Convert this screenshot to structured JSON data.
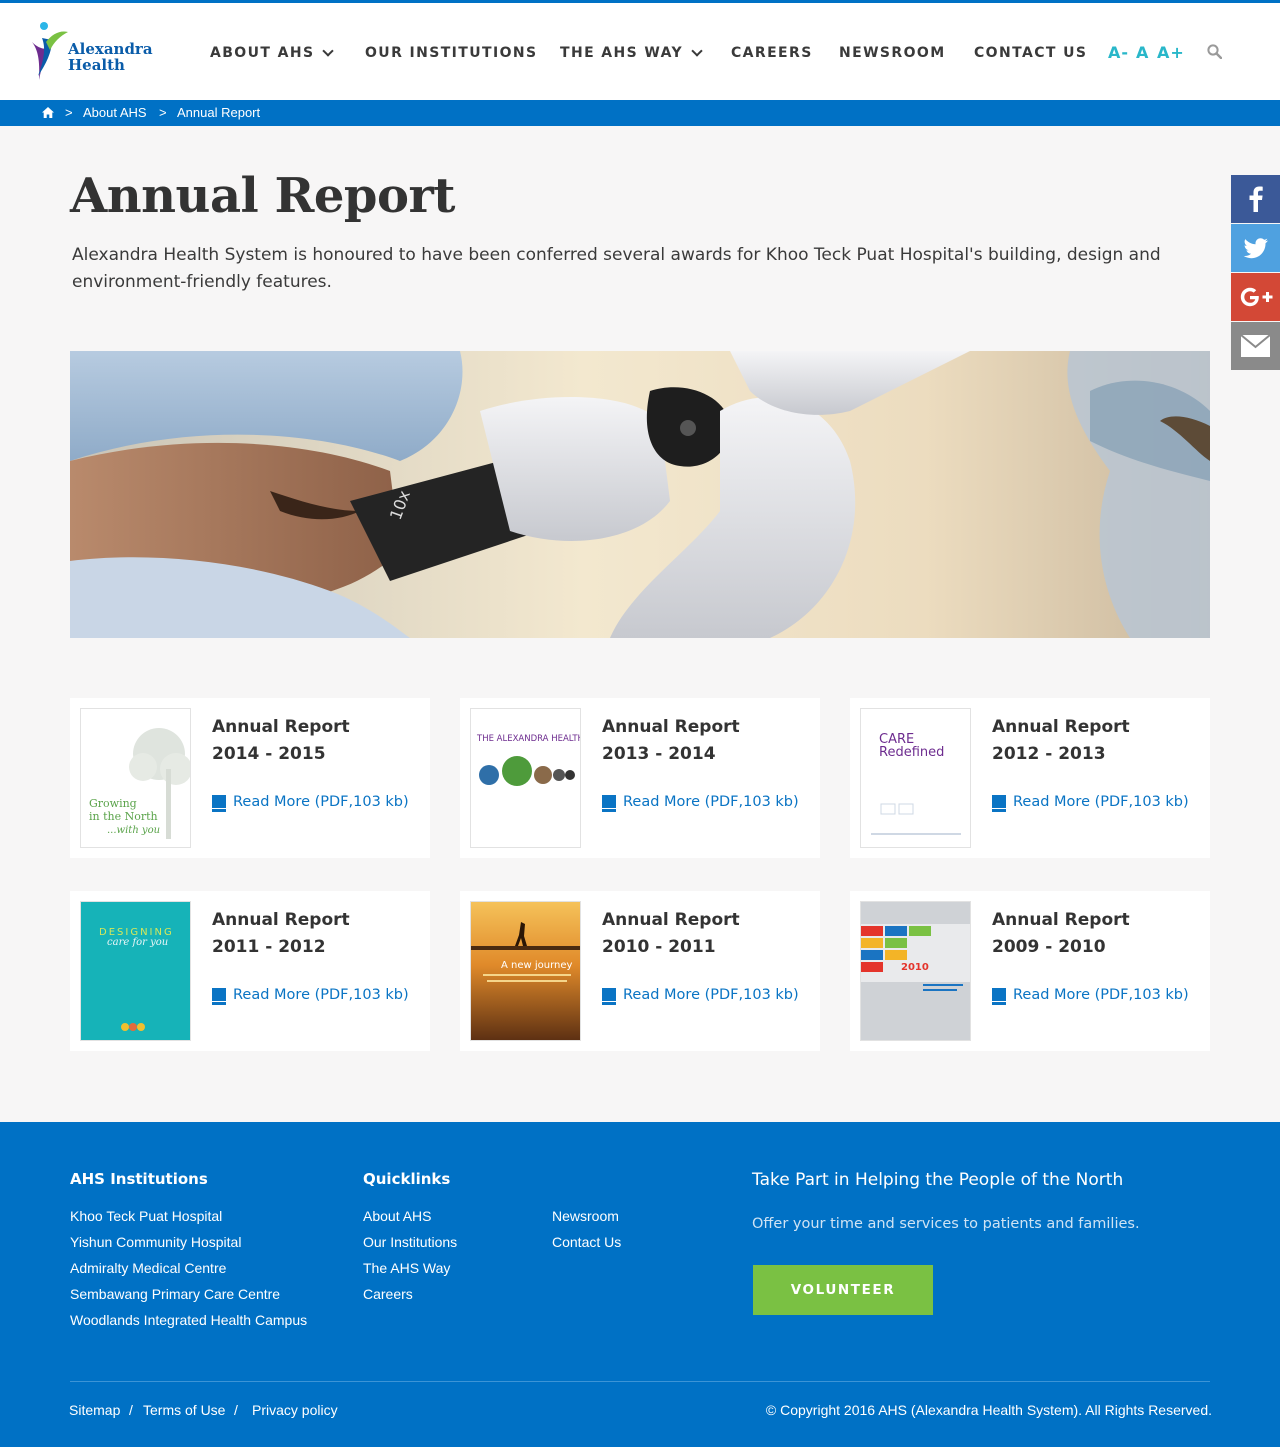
{
  "brand": {
    "name_line1": "Alexandra",
    "name_line2": "Health"
  },
  "nav": {
    "items": [
      {
        "label": "ABOUT AHS",
        "dropdown": true
      },
      {
        "label": "OUR INSTITUTIONS",
        "dropdown": false
      },
      {
        "label": "THE AHS WAY",
        "dropdown": true
      },
      {
        "label": "CAREERS",
        "dropdown": false
      },
      {
        "label": "NEWSROOM",
        "dropdown": false
      },
      {
        "label": "CONTACT US",
        "dropdown": false
      }
    ],
    "font_small": "A-",
    "font_normal": "A",
    "font_large": "A+",
    "search_icon": "search-icon"
  },
  "breadcrumb": {
    "sep": ">",
    "items": [
      "About AHS",
      "Annual Report"
    ]
  },
  "page": {
    "title": "Annual Report",
    "intro": "Alexandra Health System is honoured to have been conferred several awards for Khoo Teck Puat Hospital's building, design and environment-friendly features."
  },
  "social": [
    "facebook-icon",
    "twitter-icon",
    "google-plus-icon",
    "email-icon"
  ],
  "reports": [
    {
      "line1": "Annual Report",
      "line2": "2014 - 2015",
      "link": "Read More (PDF,103 kb)",
      "cover_text": "Growing",
      "cover_text2": "in the North",
      "cover_text3": "...with you"
    },
    {
      "line1": "Annual Report",
      "line2": "2013 - 2014",
      "link": "Read More (PDF,103 kb)",
      "cover_text": "THE ALEXANDRA HEALTH WAY"
    },
    {
      "line1": "Annual Report",
      "line2": "2012 - 2013",
      "link": "Read More (PDF,103 kb)",
      "cover_text": "CARE",
      "cover_text2": "Redefined"
    },
    {
      "line1": "Annual Report",
      "line2": "2011 - 2012",
      "link": "Read More (PDF,103 kb)",
      "cover_text": "DESIGNING",
      "cover_text2": "care for you"
    },
    {
      "line1": "Annual Report",
      "line2": "2010 - 2011",
      "link": "Read More (PDF,103 kb)",
      "cover_text": "A new journey"
    },
    {
      "line1": "Annual Report",
      "line2": "2009 - 2010",
      "link": "Read More (PDF,103 kb)",
      "cover_text": "2010"
    }
  ],
  "footer": {
    "institutions_heading": "AHS Institutions",
    "institutions": [
      "Khoo Teck Puat Hospital",
      "Yishun Community Hospital",
      "Admiralty Medical Centre",
      "Sembawang Primary Care Centre",
      "Woodlands Integrated Health Campus"
    ],
    "quicklinks_heading": "Quicklinks",
    "quicklinks_col1": [
      "About AHS",
      "Our Institutions",
      "The AHS Way",
      "Careers"
    ],
    "quicklinks_col2": [
      "Newsroom",
      "Contact Us"
    ],
    "take_part_heading": "Take Part in Helping the People of the North",
    "take_part_text": "Offer your time and services to patients and families.",
    "volunteer_label": "VOLUNTEER",
    "sitemap": "Sitemap",
    "terms": "Terms of Use",
    "privacy": "Privacy policy",
    "sep": "/",
    "copyright": "© Copyright 2016 AHS (Alexandra Health System). All Rights Reserved."
  }
}
